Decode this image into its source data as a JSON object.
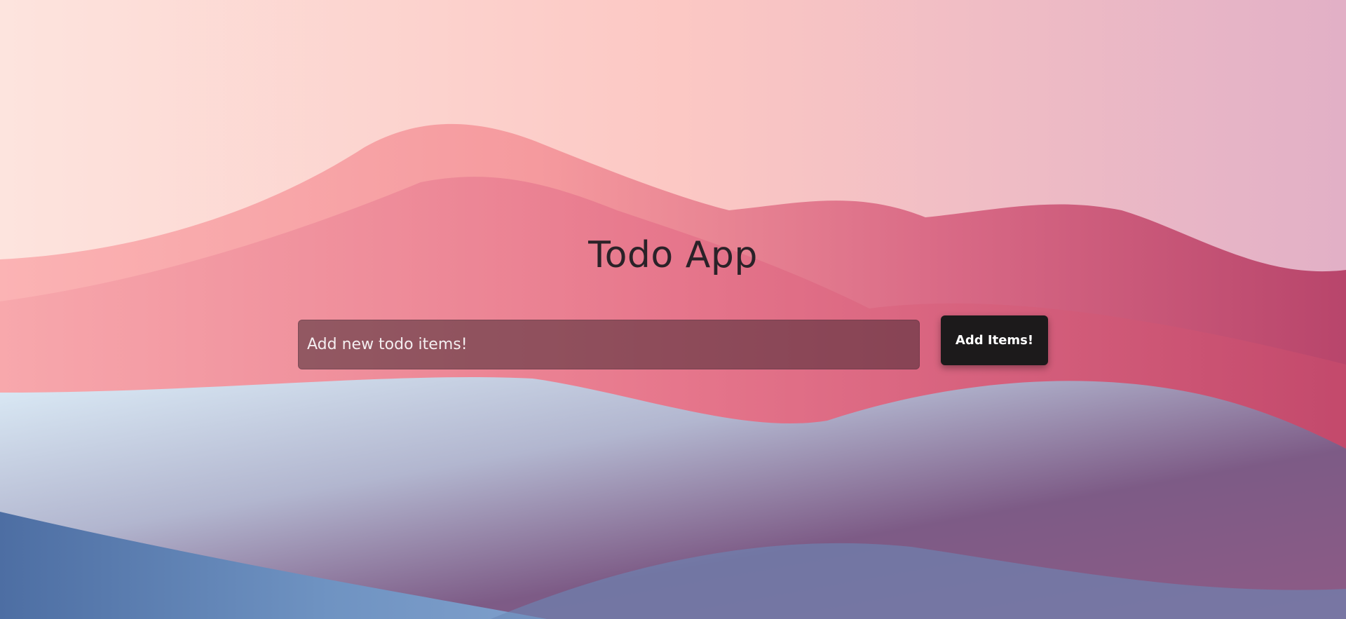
{
  "app": {
    "title": "Todo App"
  },
  "form": {
    "input_placeholder": "Add new todo items!",
    "input_value": "",
    "add_button_label": "Add Items!"
  },
  "theme": {
    "button_bg": "#1c1a1b",
    "input_bg": "#6e4650",
    "title_color": "#2a2228"
  }
}
